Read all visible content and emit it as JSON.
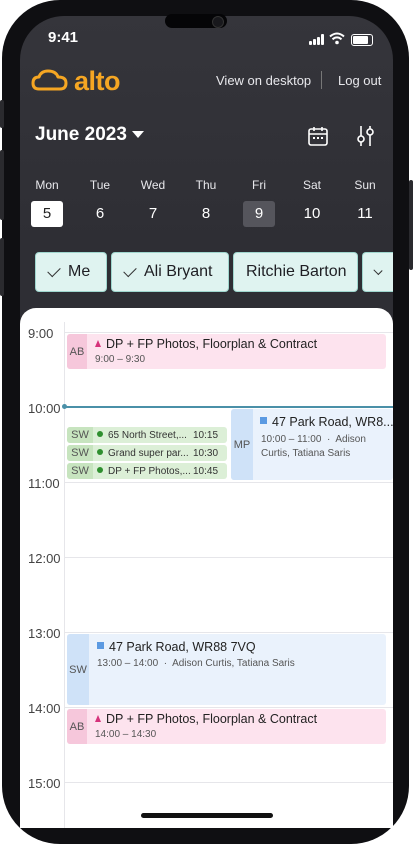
{
  "status": {
    "time": "9:41"
  },
  "header": {
    "brand": "alto",
    "view_desktop": "View on desktop",
    "logout": "Log out"
  },
  "calendar": {
    "month": "June 2023",
    "days": [
      {
        "name": "Mon",
        "num": "5"
      },
      {
        "name": "Tue",
        "num": "6"
      },
      {
        "name": "Wed",
        "num": "7"
      },
      {
        "name": "Thu",
        "num": "8"
      },
      {
        "name": "Fri",
        "num": "9"
      },
      {
        "name": "Sat",
        "num": "10"
      },
      {
        "name": "Sun",
        "num": "11"
      }
    ]
  },
  "filters": [
    {
      "label": "Me",
      "checked": true
    },
    {
      "label": "Ali Bryant",
      "checked": true
    },
    {
      "label": "Ritchie Barton",
      "checked": false
    },
    {
      "label": "",
      "checked": true
    }
  ],
  "hours": [
    "9:00",
    "10:00",
    "11:00",
    "12:00",
    "13:00",
    "14:00",
    "15:00"
  ],
  "events": {
    "e1": {
      "tag": "AB",
      "title": "DP + FP Photos, Floorplan & Contract",
      "time": "9:00 – 9:30"
    },
    "e2": {
      "tag": "MP",
      "title": "47 Park Road, WR8...",
      "time": "10:00 – 11:00",
      "people": "Adison Curtis, Tatiana Saris"
    },
    "e3": {
      "tag": "SW",
      "title": "65 North Street,...",
      "time": "10:15"
    },
    "e4": {
      "tag": "SW",
      "title": "Grand super par...",
      "time": "10:30"
    },
    "e5": {
      "tag": "SW",
      "title": "DP + FP Photos,...",
      "time": "10:45"
    },
    "e6": {
      "tag": "SW",
      "title": "47 Park Road, WR88 7VQ",
      "time": "13:00 – 14:00",
      "people": "Adison Curtis, Tatiana Saris"
    },
    "e7": {
      "tag": "AB",
      "title": "DP + FP Photos, Floorplan & Contract",
      "time": "14:00 – 14:30"
    }
  },
  "colors": {
    "brand": "#f5a623",
    "accent_chip": "#dff3f0",
    "now_line": "#4a90a8"
  }
}
